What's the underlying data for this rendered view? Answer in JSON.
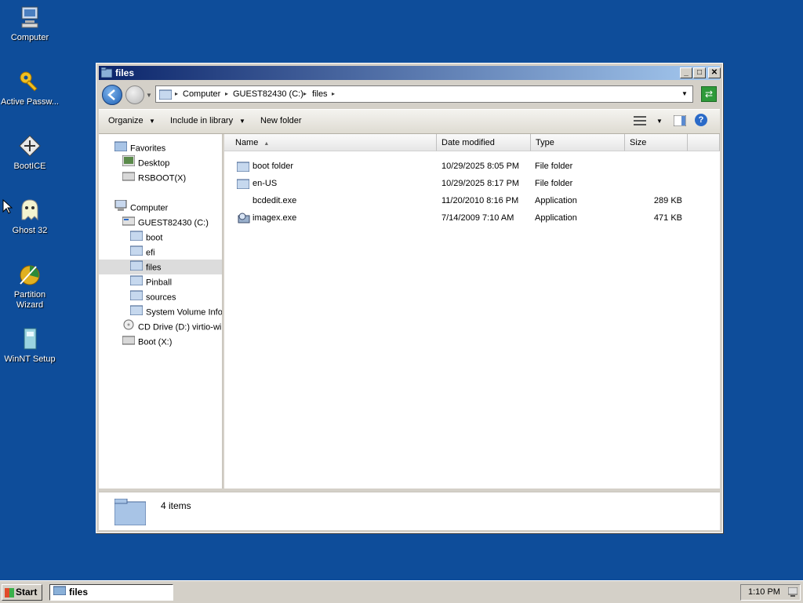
{
  "desktop": {
    "icons": [
      {
        "label": "Computer",
        "icon": "computer-icon"
      },
      {
        "label": "Active Passw...",
        "icon": "key-icon"
      },
      {
        "label": "BootICE",
        "icon": "bootice-icon"
      },
      {
        "label": "Ghost 32",
        "icon": "ghost-icon"
      },
      {
        "label": "Partition Wizard",
        "icon": "partition-wizard-icon"
      },
      {
        "label": "WinNT Setup",
        "icon": "winnt-setup-icon"
      }
    ]
  },
  "window": {
    "title": "files",
    "address": {
      "crumbs": [
        "Computer",
        "GUEST82430 (C:)",
        "files"
      ]
    },
    "toolbar": {
      "organize": "Organize",
      "include_in_library": "Include in library",
      "new_folder": "New folder"
    },
    "nav": {
      "favorites": "Favorites",
      "desktop": "Desktop",
      "rsboot": "RSBOOT(X)",
      "computer": "Computer",
      "c_drive": "GUEST82430 (C:)",
      "folders": [
        "boot",
        "efi",
        "files",
        "Pinball",
        "sources",
        "System Volume Information"
      ],
      "cd_drive": "CD Drive (D:) virtio-win",
      "boot_drive": "Boot (X:)",
      "selected": "files"
    },
    "columns": {
      "name": "Name",
      "date": "Date modified",
      "type": "Type",
      "size": "Size"
    },
    "files": [
      {
        "name": "boot folder",
        "date": "10/29/2025 8:05 PM",
        "type": "File folder",
        "size": "",
        "icon": "folder-icon"
      },
      {
        "name": "en-US",
        "date": "10/29/2025 8:17 PM",
        "type": "File folder",
        "size": "",
        "icon": "folder-icon"
      },
      {
        "name": "bcdedit.exe",
        "date": "11/20/2010 8:16 PM",
        "type": "Application",
        "size": "289 KB",
        "icon": "blank-icon"
      },
      {
        "name": "imagex.exe",
        "date": "7/14/2009 7:10 AM",
        "type": "Application",
        "size": "471 KB",
        "icon": "imagex-icon"
      }
    ],
    "status": {
      "item_count": "4 items"
    }
  },
  "taskbar": {
    "start": "Start",
    "task": "files",
    "clock": "1:10 PM"
  }
}
